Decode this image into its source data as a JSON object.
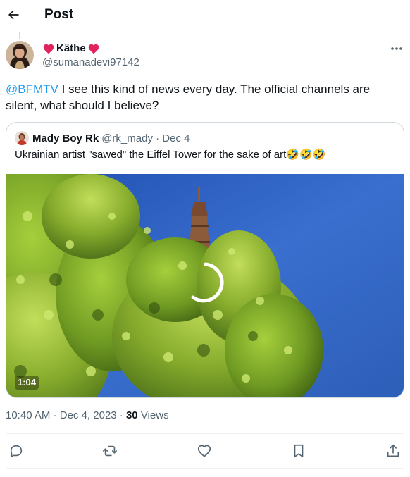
{
  "header": {
    "title": "Post"
  },
  "icons": {
    "back": "arrow-left-icon",
    "more": "more-horizontal-icon",
    "reply": "reply-icon",
    "repost": "repost-icon",
    "like": "heart-outline-icon",
    "bookmark": "bookmark-icon",
    "share": "share-icon",
    "heart_emoji": "red-heart-emoji"
  },
  "colors": {
    "accent": "#1d9bf0",
    "text": "#0f1419",
    "muted": "#536471",
    "border": "#cfd9de",
    "heart": "#e0245e"
  },
  "post": {
    "author_name": "Käthe",
    "author_handle": "@sumanadevi97142",
    "mention": "@BFMTV",
    "text": " I see this kind of news every day. The official channels are silent, what should I believe?",
    "time": "10:40 AM",
    "date": "Dec 4, 2023",
    "views_count": "30",
    "views_label": "Views"
  },
  "quote": {
    "author_name": "Mady Boy Rk",
    "author_handle": "@rk_mady",
    "date": "Dec 4",
    "text": "Ukrainian artist \"sawed\" the Eiffel Tower for the sake of art🤣🤣🤣",
    "video_duration": "1:04"
  }
}
